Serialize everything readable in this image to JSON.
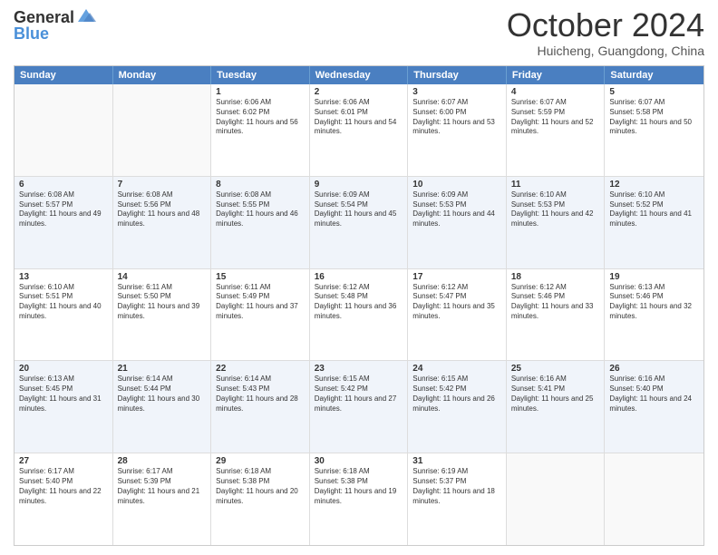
{
  "header": {
    "logo_general": "General",
    "logo_blue": "Blue",
    "month": "October 2024",
    "location": "Huicheng, Guangdong, China"
  },
  "days_of_week": [
    "Sunday",
    "Monday",
    "Tuesday",
    "Wednesday",
    "Thursday",
    "Friday",
    "Saturday"
  ],
  "rows": [
    [
      {
        "day": "",
        "empty": true
      },
      {
        "day": "",
        "empty": true
      },
      {
        "day": "1",
        "sunrise": "6:06 AM",
        "sunset": "6:02 PM",
        "daylight": "11 hours and 56 minutes."
      },
      {
        "day": "2",
        "sunrise": "6:06 AM",
        "sunset": "6:01 PM",
        "daylight": "11 hours and 54 minutes."
      },
      {
        "day": "3",
        "sunrise": "6:07 AM",
        "sunset": "6:00 PM",
        "daylight": "11 hours and 53 minutes."
      },
      {
        "day": "4",
        "sunrise": "6:07 AM",
        "sunset": "5:59 PM",
        "daylight": "11 hours and 52 minutes."
      },
      {
        "day": "5",
        "sunrise": "6:07 AM",
        "sunset": "5:58 PM",
        "daylight": "11 hours and 50 minutes."
      }
    ],
    [
      {
        "day": "6",
        "sunrise": "6:08 AM",
        "sunset": "5:57 PM",
        "daylight": "11 hours and 49 minutes."
      },
      {
        "day": "7",
        "sunrise": "6:08 AM",
        "sunset": "5:56 PM",
        "daylight": "11 hours and 48 minutes."
      },
      {
        "day": "8",
        "sunrise": "6:08 AM",
        "sunset": "5:55 PM",
        "daylight": "11 hours and 46 minutes."
      },
      {
        "day": "9",
        "sunrise": "6:09 AM",
        "sunset": "5:54 PM",
        "daylight": "11 hours and 45 minutes."
      },
      {
        "day": "10",
        "sunrise": "6:09 AM",
        "sunset": "5:53 PM",
        "daylight": "11 hours and 44 minutes."
      },
      {
        "day": "11",
        "sunrise": "6:10 AM",
        "sunset": "5:53 PM",
        "daylight": "11 hours and 42 minutes."
      },
      {
        "day": "12",
        "sunrise": "6:10 AM",
        "sunset": "5:52 PM",
        "daylight": "11 hours and 41 minutes."
      }
    ],
    [
      {
        "day": "13",
        "sunrise": "6:10 AM",
        "sunset": "5:51 PM",
        "daylight": "11 hours and 40 minutes."
      },
      {
        "day": "14",
        "sunrise": "6:11 AM",
        "sunset": "5:50 PM",
        "daylight": "11 hours and 39 minutes."
      },
      {
        "day": "15",
        "sunrise": "6:11 AM",
        "sunset": "5:49 PM",
        "daylight": "11 hours and 37 minutes."
      },
      {
        "day": "16",
        "sunrise": "6:12 AM",
        "sunset": "5:48 PM",
        "daylight": "11 hours and 36 minutes."
      },
      {
        "day": "17",
        "sunrise": "6:12 AM",
        "sunset": "5:47 PM",
        "daylight": "11 hours and 35 minutes."
      },
      {
        "day": "18",
        "sunrise": "6:12 AM",
        "sunset": "5:46 PM",
        "daylight": "11 hours and 33 minutes."
      },
      {
        "day": "19",
        "sunrise": "6:13 AM",
        "sunset": "5:46 PM",
        "daylight": "11 hours and 32 minutes."
      }
    ],
    [
      {
        "day": "20",
        "sunrise": "6:13 AM",
        "sunset": "5:45 PM",
        "daylight": "11 hours and 31 minutes."
      },
      {
        "day": "21",
        "sunrise": "6:14 AM",
        "sunset": "5:44 PM",
        "daylight": "11 hours and 30 minutes."
      },
      {
        "day": "22",
        "sunrise": "6:14 AM",
        "sunset": "5:43 PM",
        "daylight": "11 hours and 28 minutes."
      },
      {
        "day": "23",
        "sunrise": "6:15 AM",
        "sunset": "5:42 PM",
        "daylight": "11 hours and 27 minutes."
      },
      {
        "day": "24",
        "sunrise": "6:15 AM",
        "sunset": "5:42 PM",
        "daylight": "11 hours and 26 minutes."
      },
      {
        "day": "25",
        "sunrise": "6:16 AM",
        "sunset": "5:41 PM",
        "daylight": "11 hours and 25 minutes."
      },
      {
        "day": "26",
        "sunrise": "6:16 AM",
        "sunset": "5:40 PM",
        "daylight": "11 hours and 24 minutes."
      }
    ],
    [
      {
        "day": "27",
        "sunrise": "6:17 AM",
        "sunset": "5:40 PM",
        "daylight": "11 hours and 22 minutes."
      },
      {
        "day": "28",
        "sunrise": "6:17 AM",
        "sunset": "5:39 PM",
        "daylight": "11 hours and 21 minutes."
      },
      {
        "day": "29",
        "sunrise": "6:18 AM",
        "sunset": "5:38 PM",
        "daylight": "11 hours and 20 minutes."
      },
      {
        "day": "30",
        "sunrise": "6:18 AM",
        "sunset": "5:38 PM",
        "daylight": "11 hours and 19 minutes."
      },
      {
        "day": "31",
        "sunrise": "6:19 AM",
        "sunset": "5:37 PM",
        "daylight": "11 hours and 18 minutes."
      },
      {
        "day": "",
        "empty": true
      },
      {
        "day": "",
        "empty": true
      }
    ]
  ]
}
